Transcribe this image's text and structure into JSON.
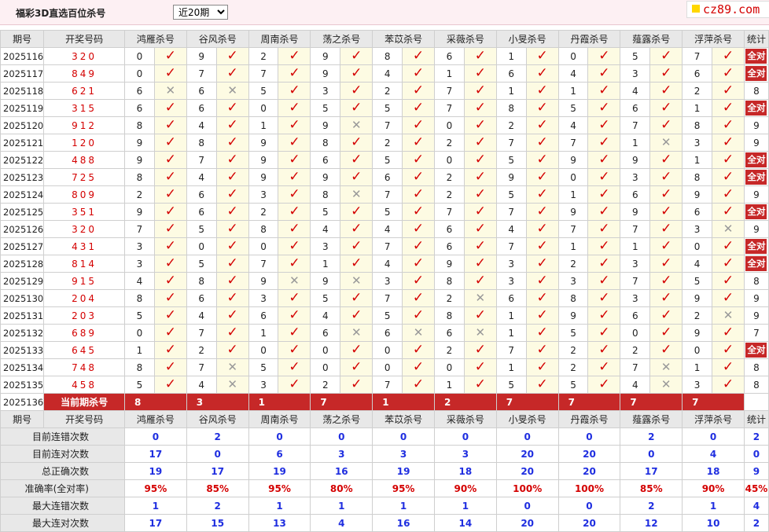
{
  "header": {
    "title": "福彩3D直选百位杀号",
    "period_option": "近20期",
    "logo_text": "cz89.com"
  },
  "columns": {
    "period": "期号",
    "number": "开奖号码",
    "experts": [
      "鸿雁杀号",
      "谷风杀号",
      "周南杀号",
      "荡之杀号",
      "苯苡杀号",
      "采薇杀号",
      "小旻杀号",
      "丹霞杀号",
      "薤露杀号",
      "浮萍杀号"
    ],
    "stat": "统计"
  },
  "rows": [
    {
      "period": "2025116",
      "number": "320",
      "picks": [
        [
          "0",
          true
        ],
        [
          "9",
          true
        ],
        [
          "2",
          true
        ],
        [
          "9",
          true
        ],
        [
          "8",
          true
        ],
        [
          "6",
          true
        ],
        [
          "1",
          true
        ],
        [
          "0",
          true
        ],
        [
          "5",
          true
        ],
        [
          "7",
          true
        ]
      ],
      "stat": "全对"
    },
    {
      "period": "2025117",
      "number": "849",
      "picks": [
        [
          "0",
          true
        ],
        [
          "7",
          true
        ],
        [
          "7",
          true
        ],
        [
          "9",
          true
        ],
        [
          "4",
          true
        ],
        [
          "1",
          true
        ],
        [
          "6",
          true
        ],
        [
          "4",
          true
        ],
        [
          "3",
          true
        ],
        [
          "6",
          true
        ]
      ],
      "stat": "全对"
    },
    {
      "period": "2025118",
      "number": "621",
      "picks": [
        [
          "6",
          false
        ],
        [
          "6",
          false
        ],
        [
          "5",
          true
        ],
        [
          "3",
          true
        ],
        [
          "2",
          true
        ],
        [
          "7",
          true
        ],
        [
          "1",
          true
        ],
        [
          "1",
          true
        ],
        [
          "4",
          true
        ],
        [
          "2",
          true
        ]
      ],
      "stat": "8"
    },
    {
      "period": "2025119",
      "number": "315",
      "picks": [
        [
          "6",
          true
        ],
        [
          "6",
          true
        ],
        [
          "0",
          true
        ],
        [
          "5",
          true
        ],
        [
          "5",
          true
        ],
        [
          "7",
          true
        ],
        [
          "8",
          true
        ],
        [
          "5",
          true
        ],
        [
          "6",
          true
        ],
        [
          "1",
          true
        ]
      ],
      "stat": "全对"
    },
    {
      "period": "2025120",
      "number": "912",
      "picks": [
        [
          "8",
          true
        ],
        [
          "4",
          true
        ],
        [
          "1",
          true
        ],
        [
          "9",
          false
        ],
        [
          "7",
          true
        ],
        [
          "0",
          true
        ],
        [
          "2",
          true
        ],
        [
          "4",
          true
        ],
        [
          "7",
          true
        ],
        [
          "8",
          true
        ]
      ],
      "stat": "9"
    },
    {
      "period": "2025121",
      "number": "120",
      "picks": [
        [
          "9",
          true
        ],
        [
          "8",
          true
        ],
        [
          "9",
          true
        ],
        [
          "8",
          true
        ],
        [
          "2",
          true
        ],
        [
          "2",
          true
        ],
        [
          "7",
          true
        ],
        [
          "7",
          true
        ],
        [
          "1",
          false
        ],
        [
          "3",
          true
        ]
      ],
      "stat": "9"
    },
    {
      "period": "2025122",
      "number": "488",
      "picks": [
        [
          "9",
          true
        ],
        [
          "7",
          true
        ],
        [
          "9",
          true
        ],
        [
          "6",
          true
        ],
        [
          "5",
          true
        ],
        [
          "0",
          true
        ],
        [
          "5",
          true
        ],
        [
          "9",
          true
        ],
        [
          "9",
          true
        ],
        [
          "1",
          true
        ]
      ],
      "stat": "全对"
    },
    {
      "period": "2025123",
      "number": "725",
      "picks": [
        [
          "8",
          true
        ],
        [
          "4",
          true
        ],
        [
          "9",
          true
        ],
        [
          "9",
          true
        ],
        [
          "6",
          true
        ],
        [
          "2",
          true
        ],
        [
          "9",
          true
        ],
        [
          "0",
          true
        ],
        [
          "3",
          true
        ],
        [
          "8",
          true
        ]
      ],
      "stat": "全对"
    },
    {
      "period": "2025124",
      "number": "809",
      "picks": [
        [
          "2",
          true
        ],
        [
          "6",
          true
        ],
        [
          "3",
          true
        ],
        [
          "8",
          false
        ],
        [
          "7",
          true
        ],
        [
          "2",
          true
        ],
        [
          "5",
          true
        ],
        [
          "1",
          true
        ],
        [
          "6",
          true
        ],
        [
          "9",
          true
        ]
      ],
      "stat": "9"
    },
    {
      "period": "2025125",
      "number": "351",
      "picks": [
        [
          "9",
          true
        ],
        [
          "6",
          true
        ],
        [
          "2",
          true
        ],
        [
          "5",
          true
        ],
        [
          "5",
          true
        ],
        [
          "7",
          true
        ],
        [
          "7",
          true
        ],
        [
          "9",
          true
        ],
        [
          "9",
          true
        ],
        [
          "6",
          true
        ]
      ],
      "stat": "全对"
    },
    {
      "period": "2025126",
      "number": "320",
      "picks": [
        [
          "7",
          true
        ],
        [
          "5",
          true
        ],
        [
          "8",
          true
        ],
        [
          "4",
          true
        ],
        [
          "4",
          true
        ],
        [
          "6",
          true
        ],
        [
          "4",
          true
        ],
        [
          "7",
          true
        ],
        [
          "7",
          true
        ],
        [
          "3",
          false
        ]
      ],
      "stat": "9"
    },
    {
      "period": "2025127",
      "number": "431",
      "picks": [
        [
          "3",
          true
        ],
        [
          "0",
          true
        ],
        [
          "0",
          true
        ],
        [
          "3",
          true
        ],
        [
          "7",
          true
        ],
        [
          "6",
          true
        ],
        [
          "7",
          true
        ],
        [
          "1",
          true
        ],
        [
          "1",
          true
        ],
        [
          "0",
          true
        ]
      ],
      "stat": "全对"
    },
    {
      "period": "2025128",
      "number": "814",
      "picks": [
        [
          "3",
          true
        ],
        [
          "5",
          true
        ],
        [
          "7",
          true
        ],
        [
          "1",
          true
        ],
        [
          "4",
          true
        ],
        [
          "9",
          true
        ],
        [
          "3",
          true
        ],
        [
          "2",
          true
        ],
        [
          "3",
          true
        ],
        [
          "4",
          true
        ]
      ],
      "stat": "全对"
    },
    {
      "period": "2025129",
      "number": "915",
      "picks": [
        [
          "4",
          true
        ],
        [
          "8",
          true
        ],
        [
          "9",
          false
        ],
        [
          "9",
          false
        ],
        [
          "3",
          true
        ],
        [
          "8",
          true
        ],
        [
          "3",
          true
        ],
        [
          "3",
          true
        ],
        [
          "7",
          true
        ],
        [
          "5",
          true
        ]
      ],
      "stat": "8"
    },
    {
      "period": "2025130",
      "number": "204",
      "picks": [
        [
          "8",
          true
        ],
        [
          "6",
          true
        ],
        [
          "3",
          true
        ],
        [
          "5",
          true
        ],
        [
          "7",
          true
        ],
        [
          "2",
          false
        ],
        [
          "6",
          true
        ],
        [
          "8",
          true
        ],
        [
          "3",
          true
        ],
        [
          "9",
          true
        ]
      ],
      "stat": "9"
    },
    {
      "period": "2025131",
      "number": "203",
      "picks": [
        [
          "5",
          true
        ],
        [
          "4",
          true
        ],
        [
          "6",
          true
        ],
        [
          "4",
          true
        ],
        [
          "5",
          true
        ],
        [
          "8",
          true
        ],
        [
          "1",
          true
        ],
        [
          "9",
          true
        ],
        [
          "6",
          true
        ],
        [
          "2",
          false
        ]
      ],
      "stat": "9"
    },
    {
      "period": "2025132",
      "number": "689",
      "picks": [
        [
          "0",
          true
        ],
        [
          "7",
          true
        ],
        [
          "1",
          true
        ],
        [
          "6",
          false
        ],
        [
          "6",
          false
        ],
        [
          "6",
          false
        ],
        [
          "1",
          true
        ],
        [
          "5",
          true
        ],
        [
          "0",
          true
        ],
        [
          "9",
          true
        ]
      ],
      "stat": "7"
    },
    {
      "period": "2025133",
      "number": "645",
      "picks": [
        [
          "1",
          true
        ],
        [
          "2",
          true
        ],
        [
          "0",
          true
        ],
        [
          "0",
          true
        ],
        [
          "0",
          true
        ],
        [
          "2",
          true
        ],
        [
          "7",
          true
        ],
        [
          "2",
          true
        ],
        [
          "2",
          true
        ],
        [
          "0",
          true
        ]
      ],
      "stat": "全对"
    },
    {
      "period": "2025134",
      "number": "748",
      "picks": [
        [
          "8",
          true
        ],
        [
          "7",
          false
        ],
        [
          "5",
          true
        ],
        [
          "0",
          true
        ],
        [
          "0",
          true
        ],
        [
          "0",
          true
        ],
        [
          "1",
          true
        ],
        [
          "2",
          true
        ],
        [
          "7",
          false
        ],
        [
          "1",
          true
        ]
      ],
      "stat": "8"
    },
    {
      "period": "2025135",
      "number": "458",
      "picks": [
        [
          "5",
          true
        ],
        [
          "4",
          false
        ],
        [
          "3",
          true
        ],
        [
          "2",
          true
        ],
        [
          "7",
          true
        ],
        [
          "1",
          true
        ],
        [
          "5",
          true
        ],
        [
          "5",
          true
        ],
        [
          "4",
          false
        ],
        [
          "3",
          true
        ]
      ],
      "stat": "8"
    }
  ],
  "current": {
    "period": "2025136",
    "label": "当前期杀号",
    "picks": [
      "8",
      "3",
      "1",
      "7",
      "1",
      "2",
      "7",
      "7",
      "7",
      "7"
    ]
  },
  "stats": [
    {
      "label": "目前连错次数",
      "values": [
        "0",
        "2",
        "0",
        "0",
        "0",
        "0",
        "0",
        "0",
        "2",
        "0"
      ],
      "total": "2",
      "style": "sv"
    },
    {
      "label": "目前连对次数",
      "values": [
        "17",
        "0",
        "6",
        "3",
        "3",
        "3",
        "20",
        "20",
        "0",
        "4"
      ],
      "total": "0",
      "style": "sv"
    },
    {
      "label": "总正确次数",
      "values": [
        "19",
        "17",
        "19",
        "16",
        "19",
        "18",
        "20",
        "20",
        "17",
        "18"
      ],
      "total": "9",
      "style": "sv"
    },
    {
      "label": "准确率(全对率)",
      "values": [
        "95%",
        "85%",
        "95%",
        "80%",
        "95%",
        "90%",
        "100%",
        "100%",
        "85%",
        "90%"
      ],
      "total": "45%",
      "style": "pr"
    },
    {
      "label": "最大连错次数",
      "values": [
        "1",
        "2",
        "1",
        "1",
        "1",
        "1",
        "0",
        "0",
        "2",
        "1"
      ],
      "total": "4",
      "style": "sv"
    },
    {
      "label": "最大连对次数",
      "values": [
        "17",
        "15",
        "13",
        "4",
        "16",
        "14",
        "20",
        "20",
        "12",
        "10"
      ],
      "total": "2",
      "style": "sv"
    }
  ],
  "colors": {
    "accent_red": "#c62828",
    "check_red": "#d40000",
    "stat_blue": "#1f2ee0",
    "mark_bg": "#fdfbe3",
    "header_bg": "#e8e8e8"
  },
  "icons": {
    "check": "check-icon",
    "cross": "cross-icon"
  }
}
